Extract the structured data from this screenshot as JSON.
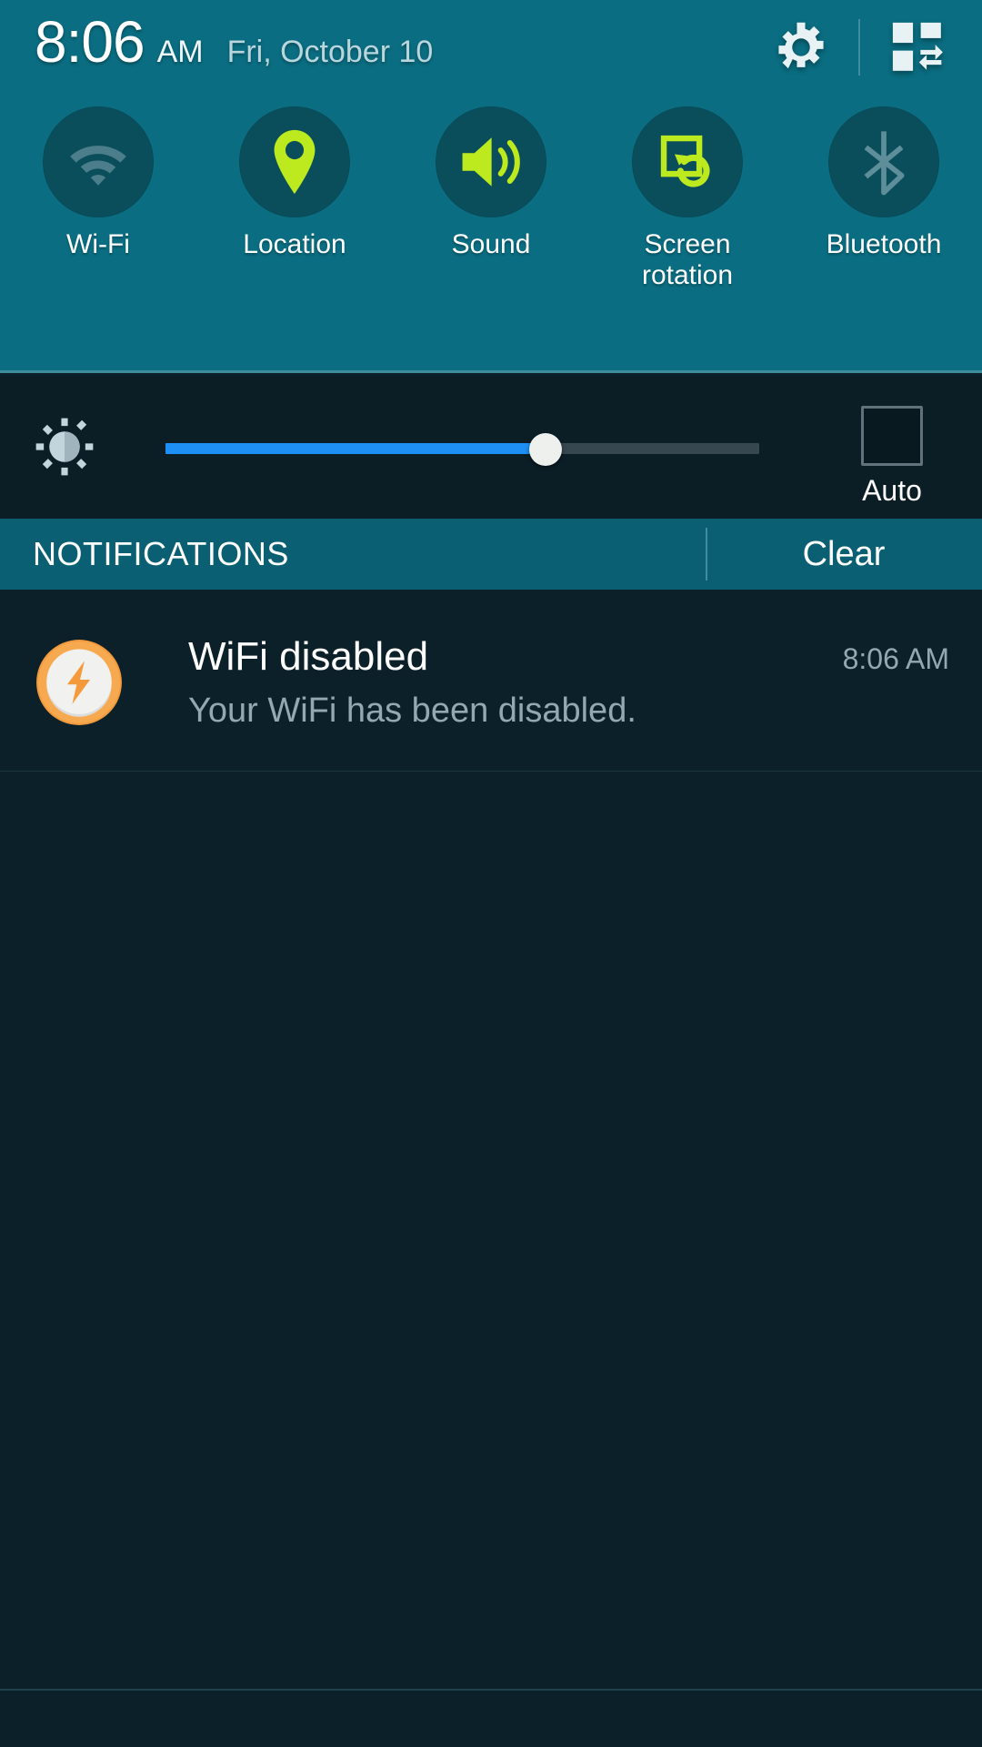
{
  "statusbar": {
    "time": "8:06",
    "ampm": "AM",
    "date": "Fri, October 10",
    "settings_icon": "gear-icon",
    "quick_settings_icon": "grid-toggle-icon"
  },
  "quick_toggles": [
    {
      "id": "wifi",
      "label": "Wi-Fi",
      "icon": "wifi-icon",
      "enabled": false,
      "color": "#4b7d8a"
    },
    {
      "id": "location",
      "label": "Location",
      "icon": "location-pin-icon",
      "enabled": true,
      "color": "#bdea1e"
    },
    {
      "id": "sound",
      "label": "Sound",
      "icon": "speaker-icon",
      "enabled": true,
      "color": "#bdea1e"
    },
    {
      "id": "rotation",
      "label": "Screen\nrotation",
      "icon": "screen-rotation-icon",
      "enabled": true,
      "color": "#bdea1e"
    },
    {
      "id": "bluetooth",
      "label": "Bluetooth",
      "icon": "bluetooth-icon",
      "enabled": false,
      "color": "#4b7d8a"
    }
  ],
  "brightness": {
    "icon": "brightness-icon",
    "value_percent": 64,
    "auto_label": "Auto",
    "auto_checked": false,
    "fill_color": "#1e90f5",
    "track_color": "#36474f"
  },
  "notifications_header": {
    "title": "NOTIFICATIONS",
    "clear_label": "Clear"
  },
  "notifications": [
    {
      "icon": "tasker-bolt-icon",
      "title": "WiFi disabled",
      "body": "Your WiFi has been disabled.",
      "time": "8:06 AM"
    }
  ],
  "theme": {
    "panel_bg": "#0a6d81",
    "shade_bg": "#0c2029",
    "brightness_bg": "#0b1e26",
    "notif_header_bg": "#0a5f72",
    "accent_on": "#bdea1e",
    "accent_off": "#4b7d8a",
    "toggle_circle": "#0a4e5c"
  }
}
